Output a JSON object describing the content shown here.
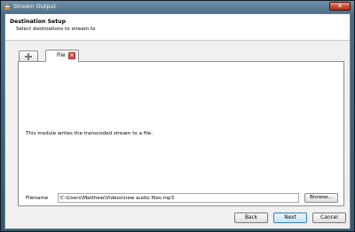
{
  "window": {
    "title": "Stream Output",
    "close_glyph": "✕"
  },
  "header": {
    "title": "Destination Setup",
    "subtitle": "Select destinations to stream to"
  },
  "tabs": [
    {
      "label": "",
      "icon": "plus-icon"
    },
    {
      "label": "File",
      "icon": "close-icon",
      "close_glyph": "✕"
    }
  ],
  "panel": {
    "description": "This module writes the transcoded stream to a file.",
    "filename_label": "Filename",
    "filename_value": "C:\\Users\\Matthew\\Videos\\new audio files.mp3",
    "browse_label": "Browse..."
  },
  "buttons": {
    "back": "Back",
    "next": "Next",
    "cancel": "Cancel"
  },
  "colors": {
    "accent": "#3c7fb1",
    "close_red": "#c9523a",
    "vlc_orange": "#f08a0a"
  }
}
